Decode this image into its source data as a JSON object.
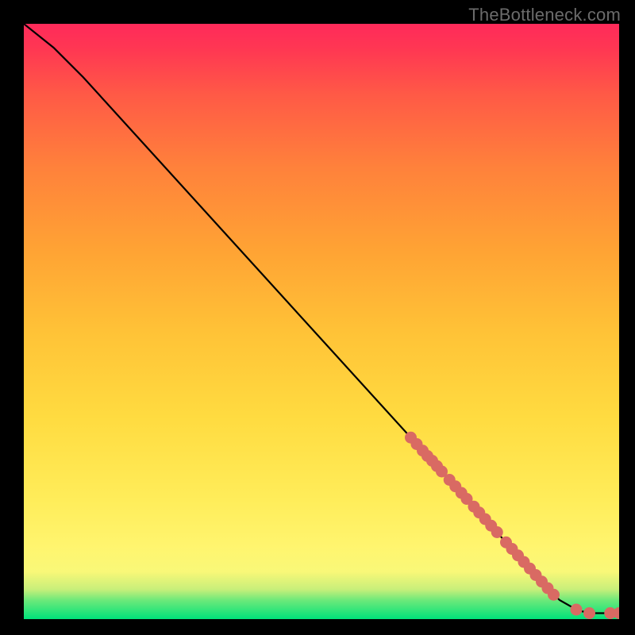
{
  "watermark": "TheBottleneck.com",
  "chart_data": {
    "type": "line",
    "title": "",
    "xlabel": "",
    "ylabel": "",
    "xlim": [
      0,
      100
    ],
    "ylim": [
      0,
      100
    ],
    "grid": false,
    "legend": false,
    "series": [
      {
        "name": "curve",
        "style": "line",
        "color": "#000000",
        "x": [
          0,
          5,
          10,
          15,
          20,
          30,
          40,
          50,
          60,
          65,
          70,
          75,
          80,
          85,
          88,
          90,
          93,
          95,
          100
        ],
        "y": [
          100,
          96,
          91,
          85.5,
          80,
          69,
          58,
          47,
          36,
          30.5,
          25,
          19.5,
          14,
          8.5,
          5.2,
          3.2,
          1.5,
          1.0,
          1.0
        ]
      },
      {
        "name": "marker-cluster",
        "style": "scatter",
        "color": "#d96a63",
        "x": [
          65.0,
          66.0,
          67.0,
          67.8,
          68.6,
          69.4,
          70.2,
          71.5,
          72.5,
          73.5,
          74.4,
          75.6,
          76.5,
          77.5,
          78.5,
          79.5,
          81.0,
          82.0,
          83.0,
          84.0,
          85.0,
          86.0,
          87.0,
          88.0,
          89.0,
          92.8,
          95.0,
          98.5,
          100.0
        ],
        "y": [
          30.5,
          29.4,
          28.3,
          27.4,
          26.6,
          25.7,
          24.8,
          23.4,
          22.3,
          21.2,
          20.2,
          18.9,
          17.9,
          16.8,
          15.7,
          14.6,
          12.9,
          11.8,
          10.7,
          9.6,
          8.5,
          7.4,
          6.3,
          5.2,
          4.1,
          1.6,
          1.0,
          1.0,
          1.0
        ]
      }
    ]
  }
}
